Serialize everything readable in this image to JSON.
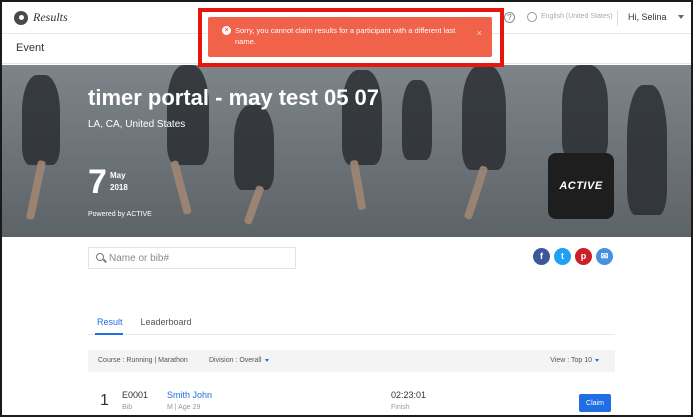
{
  "header": {
    "logo_text": "Results",
    "language": "English (United States)",
    "user_greeting": "Hi, Selina",
    "help_glyph": "?"
  },
  "subheader": {
    "title": "Event"
  },
  "alert": {
    "message": "Sorry, you cannot claim results for a participant with a different last name.",
    "close_glyph": "×",
    "icon_glyph": "×",
    "outline_color": "#e8150c",
    "background_color": "#f0624a"
  },
  "hero": {
    "title": "timer portal - may test 05 07",
    "location": "LA, CA, United States",
    "day": "7",
    "month": "May",
    "year": "2018",
    "powered_by": "Powered by ACTIVE",
    "badge_text": "ACTIVE"
  },
  "search": {
    "placeholder": "Name or bib#"
  },
  "share": [
    {
      "name": "facebook-icon",
      "glyph": "f",
      "color": "#3b5998"
    },
    {
      "name": "twitter-icon",
      "glyph": "t",
      "color": "#1da1f2"
    },
    {
      "name": "pinterest-icon",
      "glyph": "p",
      "color": "#cb2027"
    },
    {
      "name": "email-icon",
      "glyph": "✉",
      "color": "#4a90e2"
    }
  ],
  "tabs": [
    {
      "label": "Result",
      "active": true
    },
    {
      "label": "Leaderboard",
      "active": false
    }
  ],
  "filters": {
    "course": "Course : Running | Marathon",
    "division": "Division : Overall",
    "view": "View : Top 10"
  },
  "results": [
    {
      "rank": "1",
      "bib": "E0001",
      "bib_label": "Bib",
      "name": "Smith John",
      "meta": "M | Age 29",
      "time": "02:23:01",
      "status": "Finish",
      "action": "Claim"
    }
  ]
}
